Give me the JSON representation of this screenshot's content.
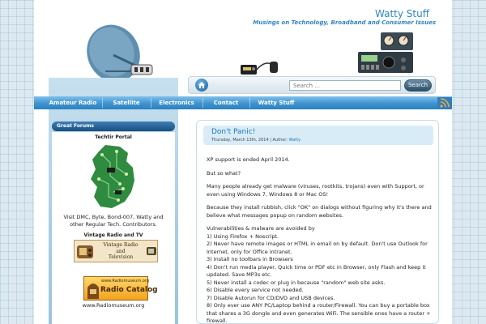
{
  "header": {
    "title": "Watty Stuff",
    "tagline": "Musings on Technology, Broadband and Consumer Issues"
  },
  "search": {
    "placeholder": "Search ...",
    "button_label": "Search"
  },
  "nav": {
    "items": [
      {
        "label": "Amateur Radio"
      },
      {
        "label": "Satellite"
      },
      {
        "label": "Electronics"
      },
      {
        "label": "Contact"
      },
      {
        "label": "Watty Stuff"
      }
    ]
  },
  "sidebar": {
    "widget_title": "Great Forums",
    "techtir_title": "Techtir Portal",
    "techtir_caption": "Visit DMC, Byte, Bond-007, Watty and other Regular Tech. Contributors.",
    "vintage_title": "Vintage Radio and TV",
    "vintage_logo_text": [
      "Vintage Radio",
      "and",
      "Television"
    ],
    "radiomuseum_logo_top": "www.Radiomuseum.org",
    "radiomuseum_logo_main": "Radio Catalog",
    "radiomuseum_caption": "www.Radiomuseum.org"
  },
  "post": {
    "title": "Don't Panic!",
    "date": "Thursday, March 13th, 2014 | Author:",
    "author": "Watty",
    "paragraphs": [
      "XP support is ended April 2014.",
      "But so what?",
      "Many people already get malware (viruses, rootkits, trojans) even with Support, or even using Windows 7, Windows 8 or Mac OS!",
      "Because they install rubbish, click \"OK\" on dialogs without figuring why it's there and believe what messages popup on random websites."
    ],
    "list_intro": "Vulnerabilities & malware  are avoided by",
    "list_items": [
      "1) Using Firefox + Noscript.",
      "2) Never have remote images or HTML in email on by default. Don't use Outlook for Internet, only for Office intranet.",
      "3) Install no toolbars in Browsers",
      "4) Don't run media player, Quick time or PDF etc in Browser, only Flash and keep it updated. Save MP3s etc.",
      "5) Never install a codec or plug in because \"random\" web site asks.",
      "6) Disable every service not needed.",
      "7) Disable Autorun for CD/DVD and USB devices.",
      "8) Only ever use ANY PC/Laptop behind a router/Firewall. You can buy a portable box that shares a 3G dongle and even generates WiFi. The sensible ones have a router + firewall."
    ]
  },
  "colors": {
    "accent": "#2f86c4",
    "nav": "#3e93cf",
    "widget_title": "#17507f"
  }
}
